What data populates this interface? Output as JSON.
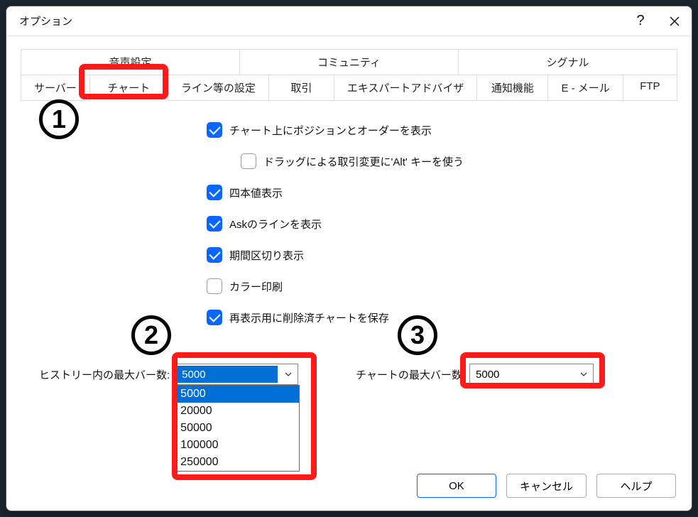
{
  "window": {
    "title": "オプション"
  },
  "tabs_top": [
    {
      "label": "音声設定"
    },
    {
      "label": "コミュニティ"
    },
    {
      "label": "シグナル"
    }
  ],
  "tabs_bottom": [
    {
      "label": "サーバー"
    },
    {
      "label": "チャート"
    },
    {
      "label": "ライン等の設定"
    },
    {
      "label": "取引"
    },
    {
      "label": "エキスパートアドバイザ"
    },
    {
      "label": "通知機能"
    },
    {
      "label": "E - メール"
    },
    {
      "label": "FTP"
    }
  ],
  "checks": {
    "show_pos": "チャート上にポジションとオーダーを表示",
    "drag_alt": "ドラッグによる取引変更に'Alt' キーを使う",
    "ohlc": "四本値表示",
    "ask_line": "Askのラインを表示",
    "period_sep": "期間区切り表示",
    "color_print": "カラー印刷",
    "save_deleted": "再表示用に削除済チャートを保存"
  },
  "fields": {
    "history_label": "ヒストリー内の最大バー数:",
    "history_value": "5000",
    "chart_label": "チャートの最大バー数:",
    "chart_value": "5000"
  },
  "dropdown": [
    "5000",
    "20000",
    "50000",
    "100000",
    "250000"
  ],
  "buttons": {
    "ok": "OK",
    "cancel": "キャンセル",
    "help": "ヘルプ"
  },
  "annotations": {
    "n1": "1",
    "n2": "2",
    "n3": "3"
  }
}
